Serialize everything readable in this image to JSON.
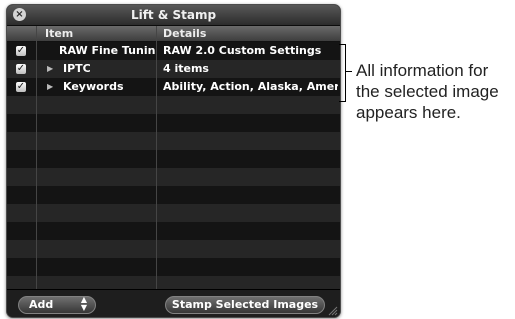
{
  "window": {
    "title": "Lift & Stamp",
    "close_glyph": "×"
  },
  "table": {
    "headers": {
      "item": "Item",
      "details": "Details"
    },
    "rows": [
      {
        "checked": true,
        "expandable": false,
        "item": "RAW Fine Tunin",
        "details": "RAW 2.0 Custom Settings"
      },
      {
        "checked": true,
        "expandable": true,
        "item": "IPTC",
        "details": "4 items"
      },
      {
        "checked": true,
        "expandable": true,
        "item": "Keywords",
        "details": "Ability, Action, Alaska, Ameri"
      }
    ]
  },
  "footer": {
    "add_label": "Add",
    "popup_arrows": "▲▼",
    "stamp_label": "Stamp Selected Images"
  },
  "callout": {
    "text": "All information for the selected image appears here."
  },
  "icons": {
    "close": "close-icon",
    "checkbox": "checkmark-icon",
    "disclosure": "disclosure-triangle-icon",
    "resize": "resize-grip-icon"
  }
}
